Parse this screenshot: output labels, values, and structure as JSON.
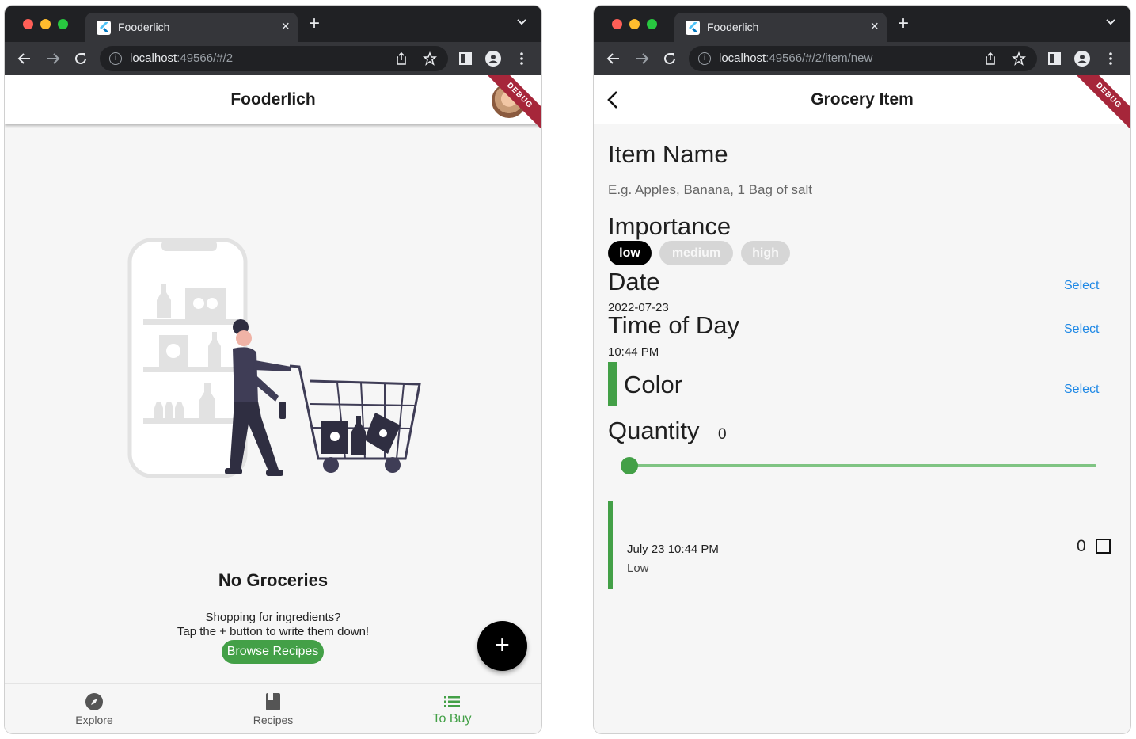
{
  "left_window": {
    "tab_title": "Fooderlich",
    "url_host": "localhost",
    "url_rest": ":49566/#/2",
    "app_title": "Fooderlich",
    "debug_label": "DEBUG",
    "empty_title": "No Groceries",
    "empty_line1": "Shopping for ingredients?",
    "empty_line2": "Tap the + button to write them down!",
    "browse_button": "Browse Recipes",
    "fab_label": "+",
    "nav": [
      {
        "label": "Explore",
        "icon": "compass-icon",
        "active": false
      },
      {
        "label": "Recipes",
        "icon": "book-icon",
        "active": false
      },
      {
        "label": "To Buy",
        "icon": "list-icon",
        "active": true
      }
    ]
  },
  "right_window": {
    "tab_title": "Fooderlich",
    "url_host": "localhost",
    "url_rest": ":49566/#/2/item/new",
    "app_title": "Grocery Item",
    "debug_label": "DEBUG",
    "item_name_label": "Item Name",
    "item_name_placeholder": "E.g. Apples, Banana, 1 Bag of salt",
    "importance_label": "Importance",
    "importance_options": [
      "low",
      "medium",
      "high"
    ],
    "importance_selected": "low",
    "date_label": "Date",
    "date_value": "2022-07-23",
    "time_label": "Time of Day",
    "time_value": "10:44 PM",
    "color_label": "Color",
    "select_label": "Select",
    "quantity_label": "Quantity",
    "quantity_value": "0",
    "quantity_slider_fraction": 0,
    "preview_date": "July 23 10:44 PM",
    "preview_importance": "Low",
    "preview_quantity": "0",
    "preview_checked": false
  },
  "colors": {
    "accent_green": "#43a047",
    "link_blue": "#1e88e5",
    "chrome_dark": "#202124",
    "chrome_toolbar": "#35363a",
    "debug_banner": "#a6263a"
  }
}
